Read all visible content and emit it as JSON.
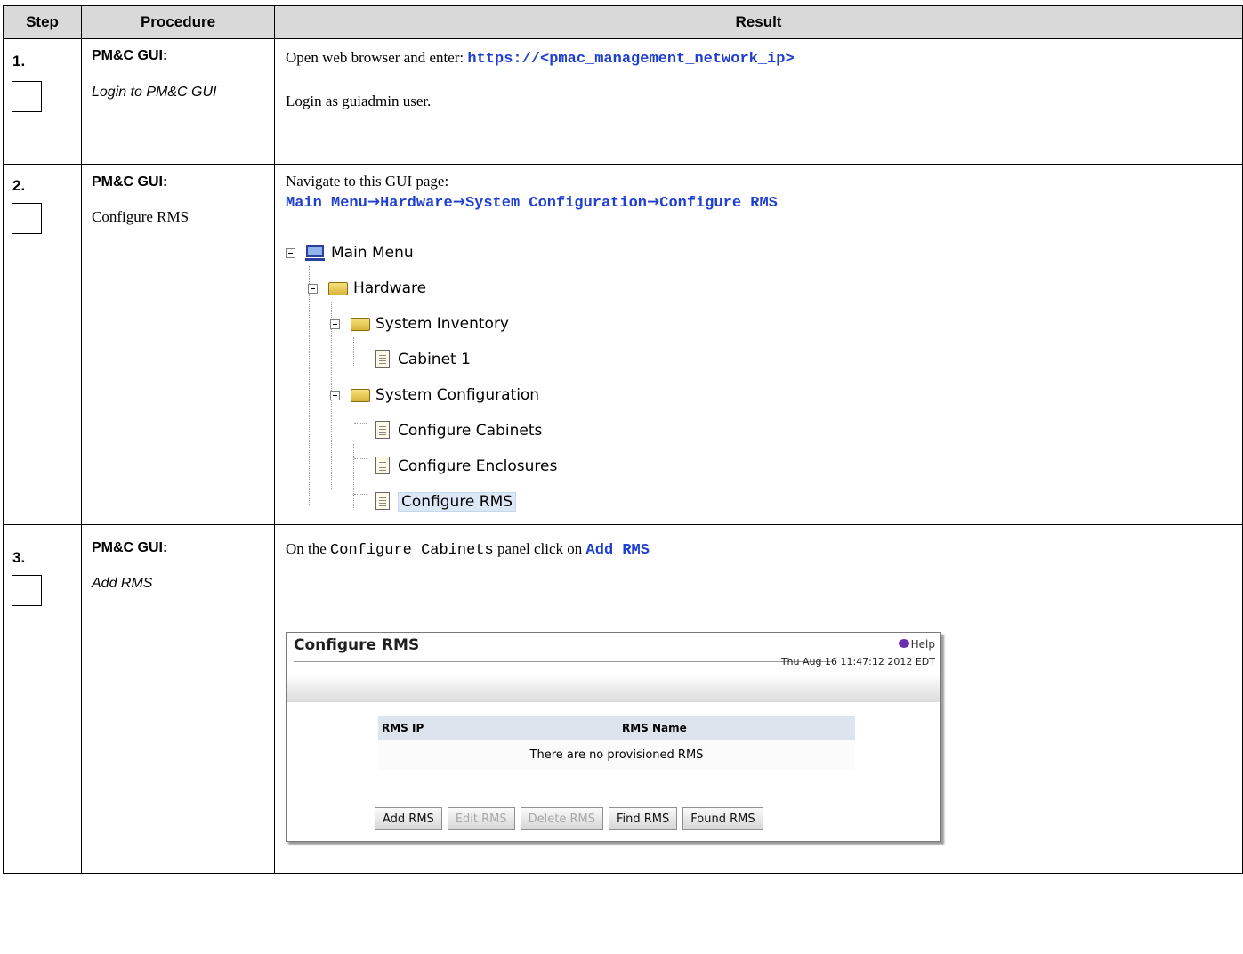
{
  "headers": {
    "step": "Step",
    "procedure": "Procedure",
    "result": "Result"
  },
  "steps": [
    {
      "num": "1.",
      "title": "PM&C GUI:",
      "subtitle": "Login to PM&C GUI",
      "line1_prefix": "Open web browser and enter: ",
      "line1_url": "https://<pmac_management_network_ip>",
      "line2": "Login as guiadmin user."
    },
    {
      "num": "2.",
      "title": "PM&C GUI:",
      "subtitle": "Configure RMS",
      "line1": "Navigate to this GUI page:",
      "path": [
        "Main Menu",
        "Hardware",
        "System Configuration",
        "Configure RMS"
      ],
      "arrow": "→",
      "tree": {
        "main_menu": "Main Menu",
        "hardware": "Hardware",
        "system_inventory": "System Inventory",
        "cabinet1": "Cabinet 1",
        "system_configuration": "System Configuration",
        "configure_cabinets": "Configure Cabinets",
        "configure_enclosures": "Configure Enclosures",
        "configure_rms": "Configure RMS"
      }
    },
    {
      "num": "3.",
      "title": "PM&C GUI:",
      "subtitle": "Add RMS",
      "line_prefix": "On the ",
      "line_mono": "Configure Cabinets",
      "line_mid": " panel click on ",
      "line_link": "Add RMS",
      "panel": {
        "title": "Configure RMS",
        "help": "Help",
        "timestamp": "Thu Aug 16 11:47:12 2012 EDT",
        "col1": "RMS IP",
        "col2": "RMS Name",
        "empty": "There are no provisioned RMS",
        "buttons": [
          "Add RMS",
          "Edit RMS",
          "Delete RMS",
          "Find RMS",
          "Found RMS"
        ]
      }
    }
  ]
}
